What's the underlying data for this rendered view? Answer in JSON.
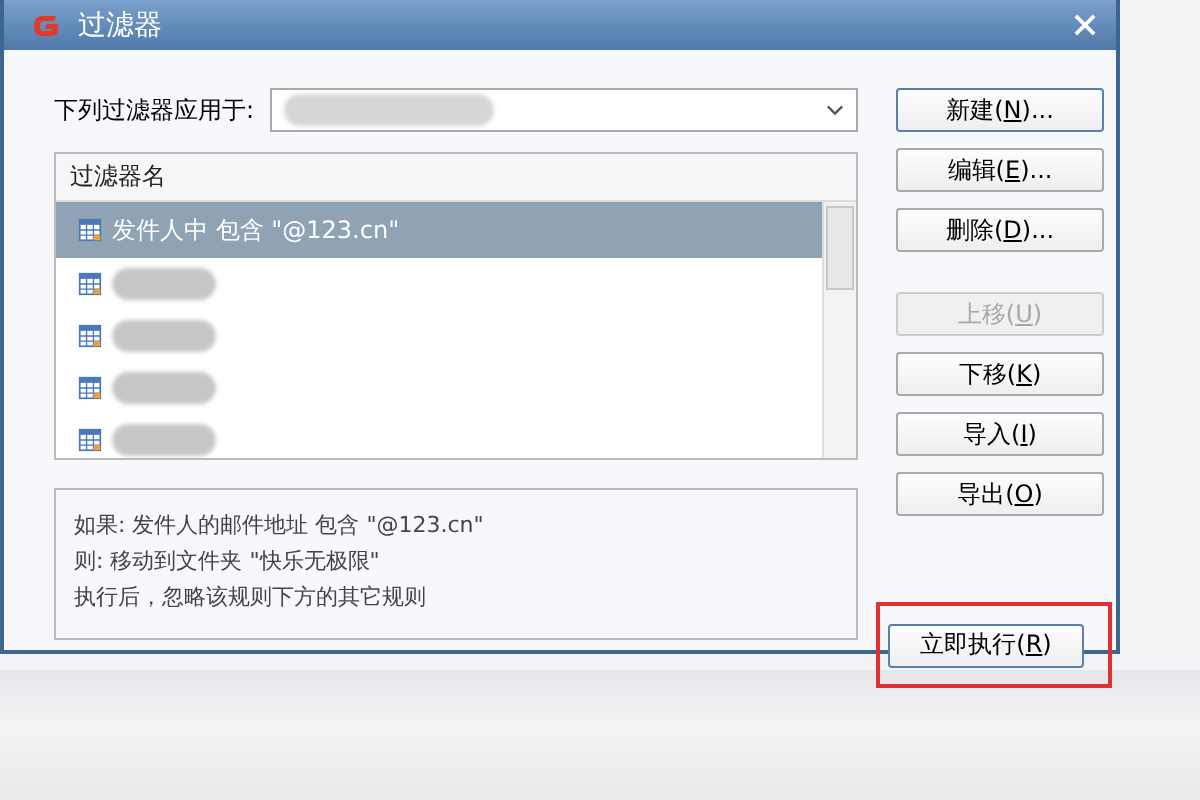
{
  "window": {
    "title": "过滤器"
  },
  "apply_to": {
    "label": "下列过滤器应用于:"
  },
  "filter_list": {
    "column": "过滤器名",
    "rows": [
      {
        "kind": "text",
        "label": "发件人中 包含 \"@123.cn\"",
        "selected": true
      },
      {
        "kind": "redacted",
        "selected": false
      },
      {
        "kind": "redacted",
        "selected": false
      },
      {
        "kind": "redacted",
        "selected": false
      },
      {
        "kind": "redacted",
        "selected": false
      }
    ]
  },
  "description": [
    "如果: 发件人的邮件地址 包含 \"@123.cn\"",
    "则: 移动到文件夹 \"快乐无极限\"",
    "执行后，忽略该规则下方的其它规则"
  ],
  "buttons": [
    {
      "before": "新建(",
      "key": "N",
      "after": ")...",
      "disabled": false
    },
    {
      "before": "编辑(",
      "key": "E",
      "after": ")...",
      "disabled": false
    },
    {
      "before": "删除(",
      "key": "D",
      "after": ")...",
      "disabled": false
    }
  ],
  "order_buttons": [
    {
      "before": "上移(",
      "key": "U",
      "after": ")",
      "disabled": true
    },
    {
      "before": "下移(",
      "key": "K",
      "after": ")",
      "disabled": false
    },
    {
      "before": "导入(",
      "key": "I",
      "after": ")",
      "disabled": false
    },
    {
      "before": "导出(",
      "key": "O",
      "after": ")",
      "disabled": false
    }
  ],
  "run_button": {
    "before": "立即执行(",
    "key": "R",
    "after": ")",
    "highlighted": true
  }
}
